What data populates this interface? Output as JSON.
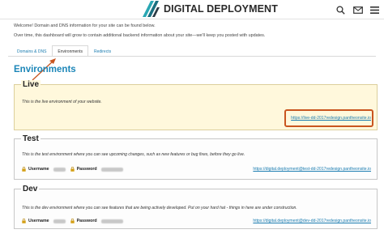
{
  "header": {
    "brand": "DIGITAL DEPLOYMENT",
    "icons": [
      "search-icon",
      "mail-icon",
      "menu-icon"
    ]
  },
  "intro": {
    "line1": "Welcome! Domain and DNS information for your site can be found below.",
    "line2": "Over time, this dashboard will grow to contain additional backend information about your site—we'll keep you posted with updates."
  },
  "tabs": [
    {
      "label": "Domains & DNS",
      "active": false
    },
    {
      "label": "Environments",
      "active": true
    },
    {
      "label": "Redirects",
      "active": false
    }
  ],
  "main": {
    "title": "Environments",
    "environments": [
      {
        "name": "Live",
        "description": "This is the live environment of your website.",
        "link": "https://live-dd-2017redesign.pantheonsite.io"
      },
      {
        "name": "Test",
        "description": "This is the test environment where you can see upcoming changes, such as new features or bug fixes, before they go live.",
        "username_label": "Username",
        "password_label": "Password",
        "link": "https://digital.deployment@test-dd-2017redesign.pantheonsite.io"
      },
      {
        "name": "Dev",
        "description": "This is the dev environment where you can see features that are being actively developed. Put on your hard hat - things in here are under construction.",
        "username_label": "Username",
        "password_label": "Password",
        "link": "https://digital.deployment@dev-dd-2017redesign.pantheonsite.io"
      }
    ]
  },
  "colors": {
    "accent": "#1c86b8",
    "link": "#1a7cb0",
    "live_bg": "#fff8dc",
    "highlight": "#c9551f",
    "logo_teal": "#2aa7b3"
  }
}
